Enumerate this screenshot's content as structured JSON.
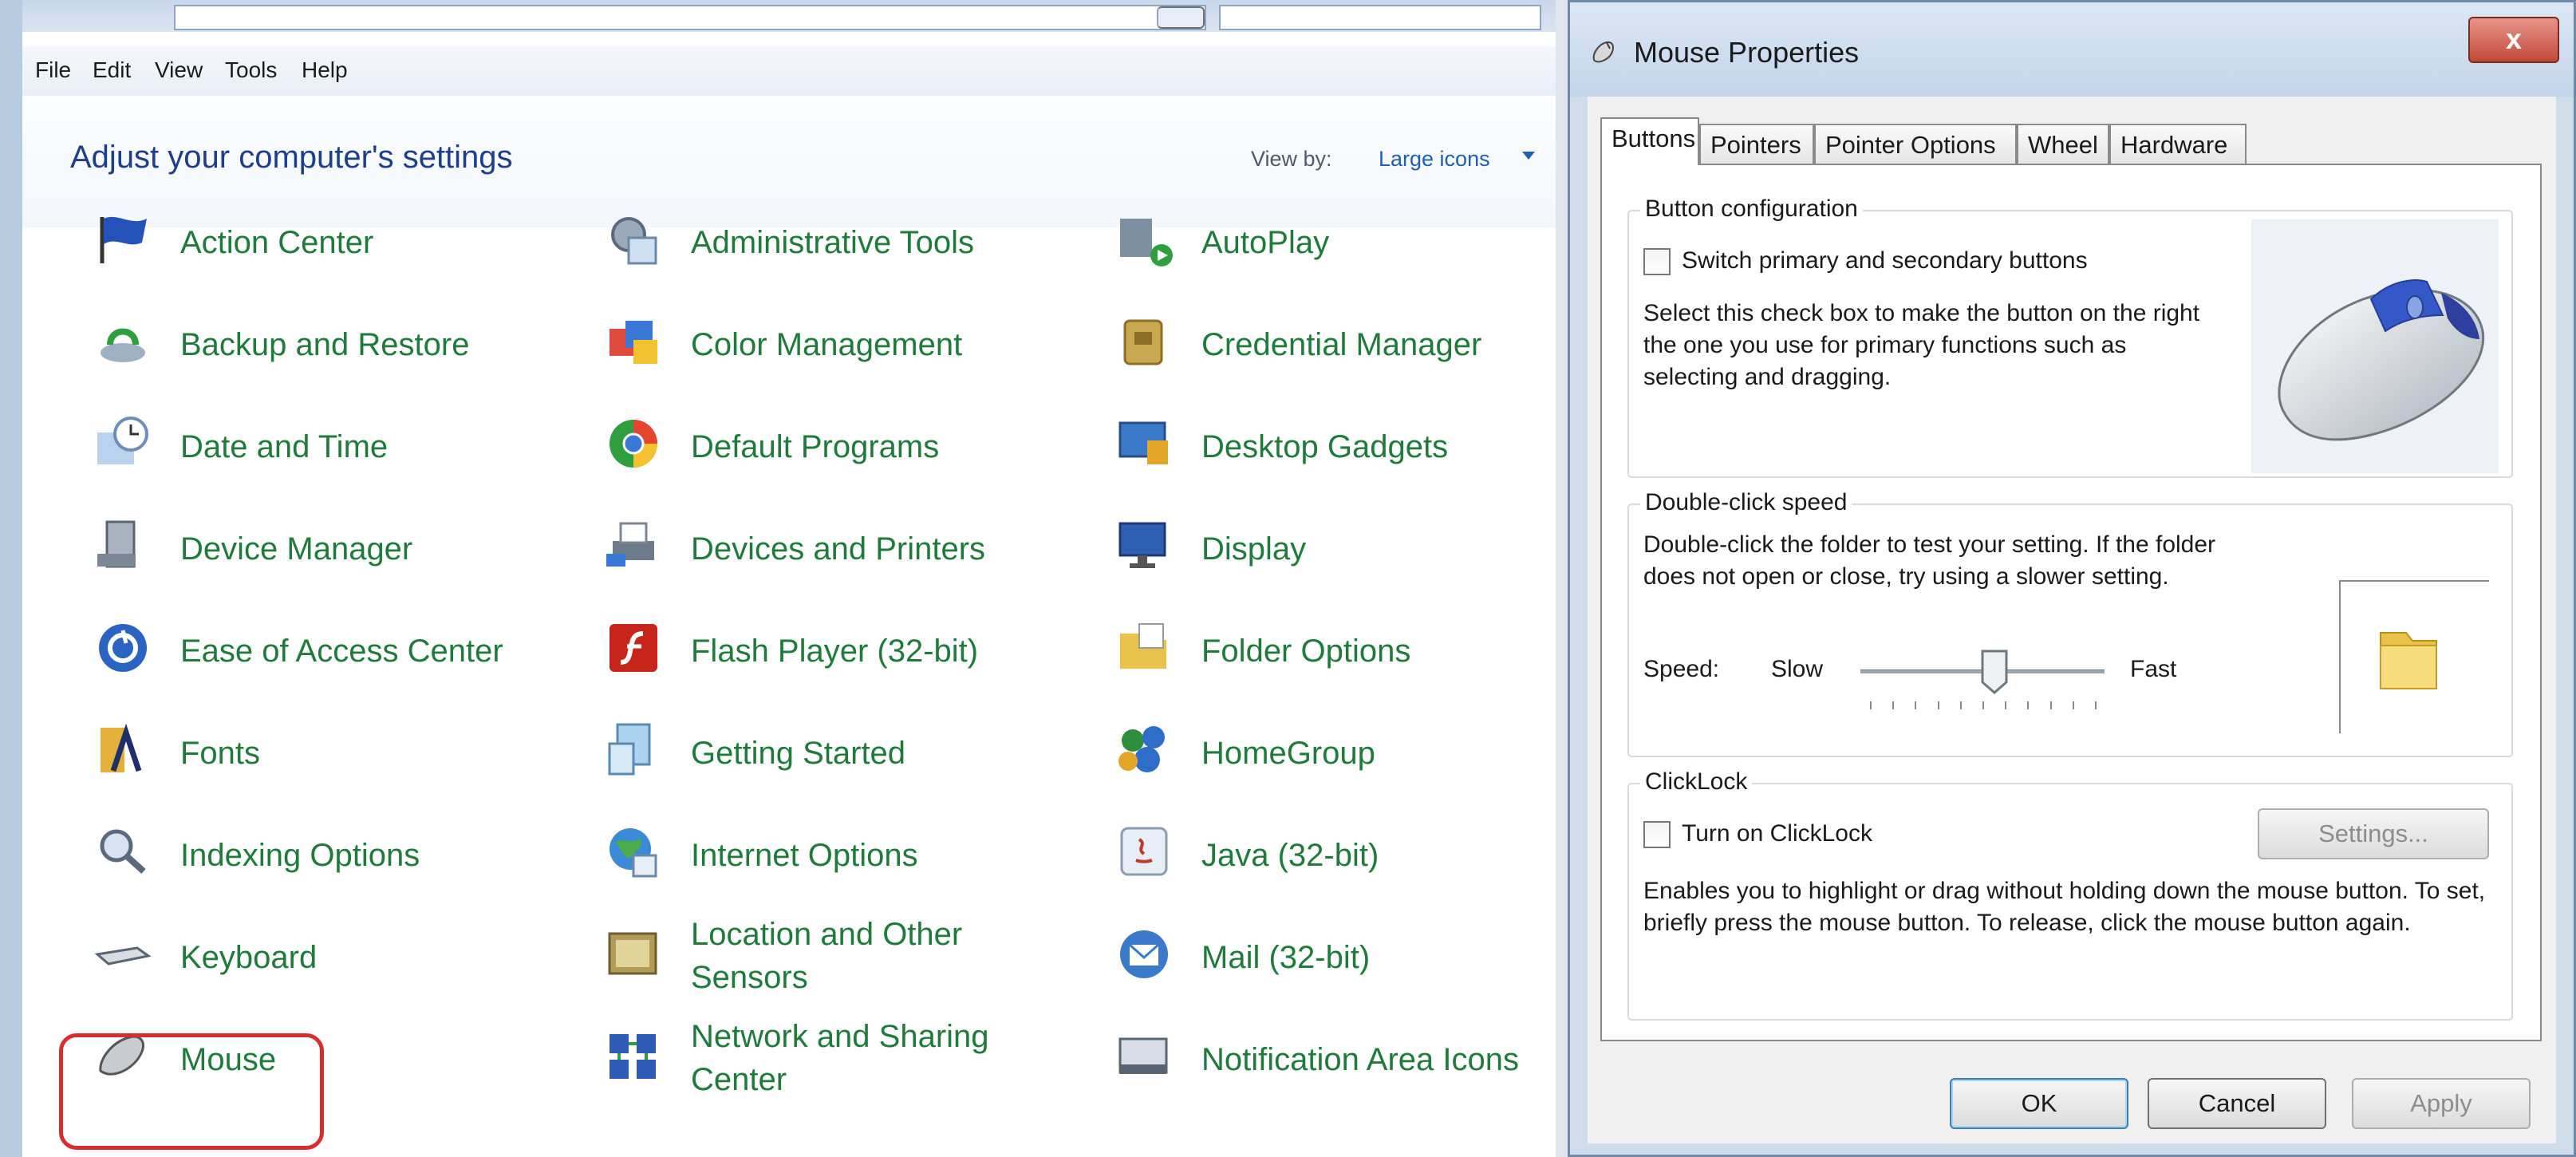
{
  "control_panel": {
    "menu": [
      "File",
      "Edit",
      "View",
      "Tools",
      "Help"
    ],
    "title": "Adjust your computer's settings",
    "view_by_label": "View by:",
    "view_by_value": "Large icons",
    "items": [
      {
        "label": "Action Center",
        "icon": "flag-icon"
      },
      {
        "label": "Administrative Tools",
        "icon": "admin-tools-icon"
      },
      {
        "label": "AutoPlay",
        "icon": "autoplay-icon"
      },
      {
        "label": "Backup and Restore",
        "icon": "backup-icon"
      },
      {
        "label": "Color Management",
        "icon": "color-management-icon"
      },
      {
        "label": "Credential Manager",
        "icon": "credential-icon"
      },
      {
        "label": "Date and Time",
        "icon": "clock-icon"
      },
      {
        "label": "Default Programs",
        "icon": "default-programs-icon"
      },
      {
        "label": "Desktop Gadgets",
        "icon": "gadgets-icon"
      },
      {
        "label": "Device Manager",
        "icon": "device-manager-icon"
      },
      {
        "label": "Devices and Printers",
        "icon": "printer-icon"
      },
      {
        "label": "Display",
        "icon": "display-icon"
      },
      {
        "label": "Ease of Access Center",
        "icon": "ease-of-access-icon"
      },
      {
        "label": "Flash Player (32-bit)",
        "icon": "flash-icon"
      },
      {
        "label": "Folder Options",
        "icon": "folder-options-icon"
      },
      {
        "label": "Fonts",
        "icon": "fonts-icon"
      },
      {
        "label": "Getting Started",
        "icon": "getting-started-icon"
      },
      {
        "label": "HomeGroup",
        "icon": "homegroup-icon"
      },
      {
        "label": "Indexing Options",
        "icon": "indexing-icon"
      },
      {
        "label": "Internet Options",
        "icon": "globe-icon"
      },
      {
        "label": "Java (32-bit)",
        "icon": "java-icon"
      },
      {
        "label": "Keyboard",
        "icon": "keyboard-icon"
      },
      {
        "label": "Location and Other Sensors",
        "icon": "sensors-icon"
      },
      {
        "label": "Mail (32-bit)",
        "icon": "mail-icon"
      },
      {
        "label": "Mouse",
        "icon": "mouse-icon"
      },
      {
        "label": "Network and Sharing Center",
        "icon": "network-icon"
      },
      {
        "label": "Notification Area Icons",
        "icon": "notification-icon"
      }
    ]
  },
  "dialog": {
    "title": "Mouse Properties",
    "close_label": "x",
    "tabs": [
      "Buttons",
      "Pointers",
      "Pointer Options",
      "Wheel",
      "Hardware"
    ],
    "active_tab": "Buttons",
    "button_config": {
      "title": "Button configuration",
      "checkbox_label": "Switch primary and secondary buttons",
      "checked": false,
      "description": "Select this check box to make the button on the right the one you use for primary functions such as selecting and dragging."
    },
    "double_click": {
      "title": "Double-click speed",
      "description": "Double-click the folder to test your setting. If the folder does not open or close, try using a slower setting.",
      "speed_label": "Speed:",
      "slow_label": "Slow",
      "fast_label": "Fast",
      "speed_fraction": 0.55
    },
    "clicklock": {
      "title": "ClickLock",
      "checkbox_label": "Turn on ClickLock",
      "checked": false,
      "settings_button": "Settings...",
      "description": "Enables you to highlight or drag without holding down the mouse button. To set, briefly press the mouse button. To release, click the mouse button again."
    },
    "buttons": {
      "ok": "OK",
      "cancel": "Cancel",
      "apply": "Apply"
    }
  }
}
